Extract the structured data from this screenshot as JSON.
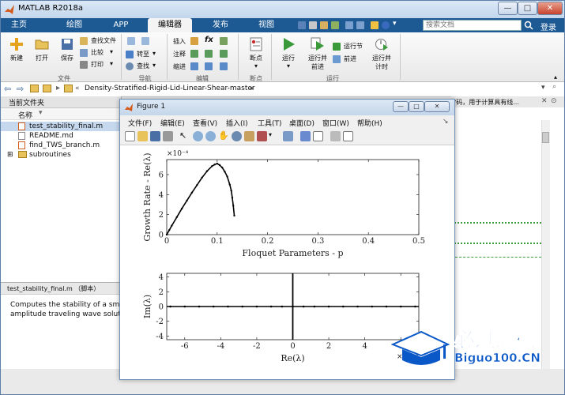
{
  "app": {
    "title": "MATLAB R2018a"
  },
  "ribbon": {
    "tabs": [
      {
        "label": "主页"
      },
      {
        "label": "绘图"
      },
      {
        "label": "APP"
      },
      {
        "label": "编辑器",
        "active": true
      },
      {
        "label": "发布"
      },
      {
        "label": "视图"
      }
    ],
    "search_placeholder": "搜索文档",
    "login_label": "登录",
    "file": {
      "new": "新建",
      "open": "打开",
      "save": "保存",
      "find_files": "查找文件",
      "compare": "比较",
      "print": "打印",
      "group": "文件"
    },
    "nav": {
      "goto": "转至",
      "find": "查找",
      "group": "导航"
    },
    "edit": {
      "insert": "插入",
      "comment": "注释",
      "indent": "缩进",
      "fx": "fx",
      "group": "编辑"
    },
    "breakpoints": {
      "label": "断点",
      "group": "断点"
    },
    "run": {
      "run": "运行",
      "run_advance_1": "运行并",
      "run_advance_2": "前进",
      "run_section": "运行节",
      "advance": "前进",
      "run_time_1": "运行并",
      "run_time_2": "计时",
      "group": "运行"
    }
  },
  "address": {
    "path": "Density-Stratified-Rigid-Lid-Linear-Shear-master"
  },
  "current_folder": {
    "title": "当前文件夹",
    "column_name": "名称",
    "files": [
      {
        "name": "test_stability_final.m",
        "selected": true
      },
      {
        "name": "README.md"
      },
      {
        "name": "find_TWS_branch.m"
      },
      {
        "name": "subroutines",
        "folder": true
      }
    ]
  },
  "detail": {
    "title": "test_stability_final.m （脚本）",
    "line1": "Computes the stability of a smal",
    "line2": "amplitude traveling wave solutio"
  },
  "right_pane": {
    "hint": "?码，用于计算具有线..."
  },
  "figure": {
    "title": "Figure 1",
    "menu": [
      "文件(F)",
      "编辑(E)",
      "查看(V)",
      "插入(I)",
      "工具(T)",
      "桌面(D)",
      "窗口(W)",
      "帮助(H)"
    ]
  },
  "chart_data": [
    {
      "type": "scatter",
      "title": "",
      "xlabel": "Floquet Parameters - p",
      "ylabel": "Growth Rate - Re(λ)",
      "y_multiplier": "×10⁻⁴",
      "xlim": [
        0,
        0.5
      ],
      "ylim": [
        0,
        7.5
      ],
      "xticks": [
        0,
        0.1,
        0.2,
        0.3,
        0.4,
        0.5
      ],
      "yticks": [
        0,
        2,
        4,
        6
      ],
      "xtick_labels": [
        "0",
        "0.1",
        "0.2",
        "0.3",
        "0.4",
        "0.5"
      ],
      "ytick_labels": [
        "0",
        "2",
        "4",
        "6"
      ],
      "x": [
        0,
        0.005,
        0.01,
        0.02,
        0.03,
        0.04,
        0.05,
        0.06,
        0.07,
        0.08,
        0.09,
        0.095,
        0.1,
        0.105,
        0.11,
        0.115,
        0.12,
        0.125,
        0.128,
        0.13,
        0.132,
        0.134
      ],
      "y": [
        0,
        0.45,
        0.9,
        1.75,
        2.6,
        3.4,
        4.2,
        4.95,
        5.7,
        6.35,
        6.85,
        7.0,
        7.1,
        6.95,
        6.7,
        6.3,
        5.8,
        5.0,
        4.4,
        3.7,
        2.9,
        1.9
      ],
      "grid": false
    },
    {
      "type": "scatter",
      "title": "",
      "xlabel": "Re(λ)",
      "ylabel": "Im(λ)",
      "x_multiplier": "×10⁻⁴",
      "xlim": [
        -7,
        7
      ],
      "ylim": [
        -4.5,
        4.5
      ],
      "xticks": [
        -6,
        -4,
        -2,
        0,
        2,
        4,
        6
      ],
      "yticks": [
        -4,
        -2,
        0,
        2,
        4
      ],
      "xtick_labels": [
        "-6",
        "-4",
        "-2",
        "0",
        "2",
        "4",
        "6"
      ],
      "ytick_labels": [
        "-4",
        "-2",
        "0",
        "2",
        "4"
      ],
      "x": [
        -6.8,
        -6.0,
        -5.2,
        -4.4,
        -3.6,
        -2.8,
        -2.0,
        -1.2,
        -0.6,
        0,
        0.6,
        1.2,
        2.0,
        2.8,
        3.6,
        4.4,
        5.2,
        6.0,
        6.8
      ],
      "y": [
        0,
        0,
        0,
        0,
        0,
        0,
        0,
        0,
        0,
        0,
        0,
        0,
        0,
        0,
        0,
        0,
        0,
        0,
        0
      ],
      "grid": false
    }
  ],
  "watermark": {
    "cn": "必过源码",
    "en": "Biguo100.CN"
  },
  "colors": {
    "ribbon_tab_bg": "#1d5a93",
    "accent_green": "#3a9a3a",
    "selection": "#c5d8ee"
  }
}
